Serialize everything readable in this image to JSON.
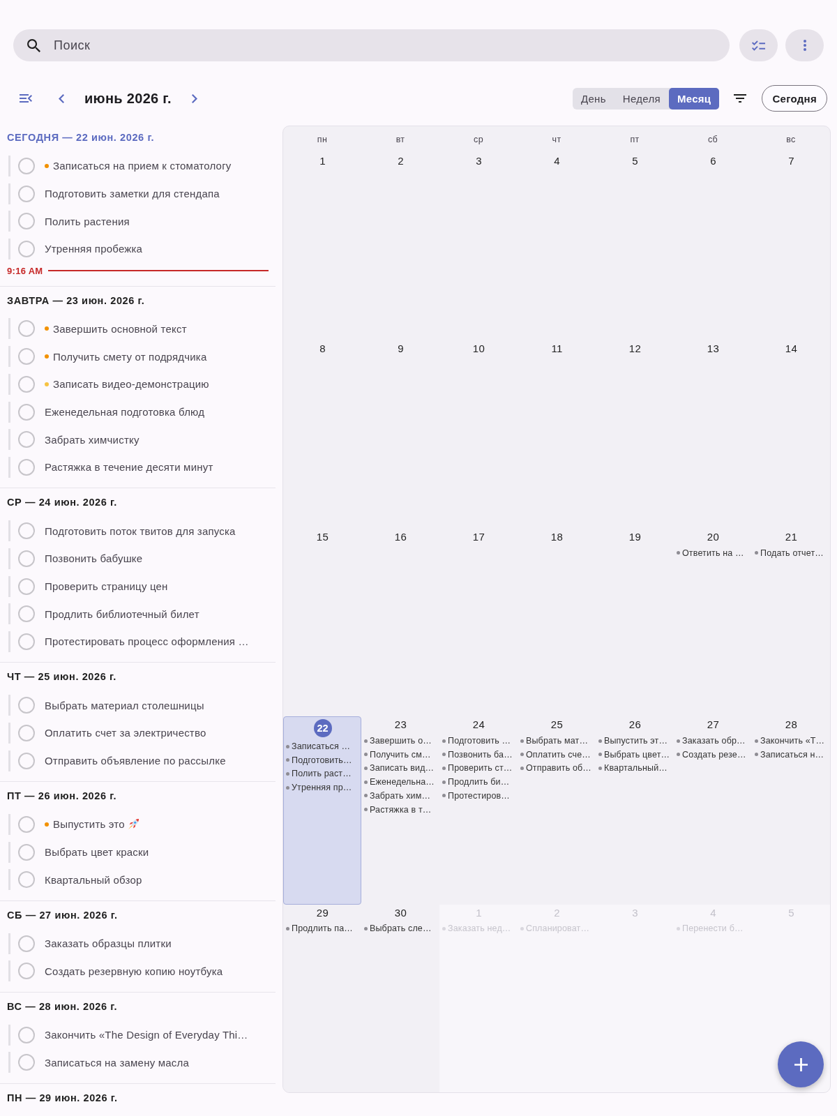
{
  "search": {
    "placeholder": "Поиск"
  },
  "header": {
    "title": "июнь 2026 г.",
    "views": [
      {
        "label": "День",
        "selected": false
      },
      {
        "label": "Неделя",
        "selected": false
      },
      {
        "label": "Месяц",
        "selected": true
      }
    ],
    "today_button": "Сегодня"
  },
  "agenda": {
    "sections": [
      {
        "title": "СЕГОДНЯ — 22 июн. 2026 г.",
        "today": true,
        "tasks": [
          {
            "text": "Записаться на прием к стоматологу",
            "checked": false,
            "color": "#f29100"
          },
          {
            "text": "Подготовить заметки для стендапа",
            "checked": false
          },
          {
            "text": "Полить растения",
            "checked": false
          },
          {
            "text": "Утренняя пробежка",
            "checked": false
          }
        ],
        "now_marker": "9:16 AM"
      },
      {
        "title": "ЗАВТРА — 23 июн. 2026 г.",
        "today": false,
        "tasks": [
          {
            "text": "Завершить основной текст",
            "checked": false,
            "color": "#f29100"
          },
          {
            "text": "Получить смету от подрядчика",
            "checked": false,
            "color": "#f29100"
          },
          {
            "text": "Записать видео-демонстрацию",
            "checked": false,
            "color": "#f6c343"
          },
          {
            "text": "Еженедельная подготовка блюд",
            "checked": false
          },
          {
            "text": "Забрать химчистку",
            "checked": false
          },
          {
            "text": "Растяжка в течение десяти минут",
            "checked": false
          }
        ]
      },
      {
        "title": "СР — 24 июн. 2026 г.",
        "today": false,
        "tasks": [
          {
            "text": "Подготовить поток твитов для запуска",
            "checked": false
          },
          {
            "text": "Позвонить бабушке",
            "checked": false
          },
          {
            "text": "Проверить страницу цен",
            "checked": false
          },
          {
            "text": "Продлить библиотечный билет",
            "checked": false
          },
          {
            "text": "Протестировать процесс оформления …",
            "checked": false
          }
        ]
      },
      {
        "title": "ЧТ — 25 июн. 2026 г.",
        "today": false,
        "tasks": [
          {
            "text": "Выбрать материал столешницы",
            "checked": false
          },
          {
            "text": "Оплатить счет за электричество",
            "checked": false
          },
          {
            "text": "Отправить объявление по рассылке",
            "checked": false
          }
        ]
      },
      {
        "title": "ПТ — 26 июн. 2026 г.",
        "today": false,
        "tasks": [
          {
            "text": "Выпустить это",
            "checked": false,
            "color": "#f29100",
            "emoji": true
          },
          {
            "text": "Выбрать цвет краски",
            "checked": false
          },
          {
            "text": "Квартальный обзор",
            "checked": false
          }
        ]
      },
      {
        "title": "СБ — 27 июн. 2026 г.",
        "today": false,
        "tasks": [
          {
            "text": "Заказать образцы плитки",
            "checked": false
          },
          {
            "text": "Создать резервную копию ноутбука",
            "checked": false
          }
        ]
      },
      {
        "title": "ВС — 28 июн. 2026 г.",
        "today": false,
        "tasks": [
          {
            "text": "Закончить «The Design of Everyday Thi…",
            "checked": false
          },
          {
            "text": "Записаться на замену масла",
            "checked": false
          }
        ]
      },
      {
        "title": "ПН — 29 июн. 2026 г.",
        "today": false
      }
    ]
  },
  "calendar": {
    "weekdays": [
      "пн",
      "вт",
      "ср",
      "чт",
      "пт",
      "сб",
      "вс"
    ],
    "weeks": [
      [
        {
          "day": "1",
          "today": false,
          "outside": false
        },
        {
          "day": "2",
          "today": false,
          "outside": false
        },
        {
          "day": "3",
          "today": false,
          "outside": false
        },
        {
          "day": "4",
          "today": false,
          "outside": false
        },
        {
          "day": "5",
          "today": false,
          "outside": false
        },
        {
          "day": "6",
          "today": false,
          "outside": false
        },
        {
          "day": "7",
          "today": false,
          "outside": false
        }
      ],
      [
        {
          "day": "8",
          "today": false,
          "outside": false
        },
        {
          "day": "9",
          "today": false,
          "outside": false
        },
        {
          "day": "10",
          "today": false,
          "outside": false
        },
        {
          "day": "11",
          "today": false,
          "outside": false
        },
        {
          "day": "12",
          "today": false,
          "outside": false
        },
        {
          "day": "13",
          "today": false,
          "outside": false
        },
        {
          "day": "14",
          "today": false,
          "outside": false
        }
      ],
      [
        {
          "day": "15",
          "today": false,
          "outside": false
        },
        {
          "day": "16",
          "today": false,
          "outside": false
        },
        {
          "day": "17",
          "today": false,
          "outside": false
        },
        {
          "day": "18",
          "today": false,
          "outside": false
        },
        {
          "day": "19",
          "today": false,
          "outside": false
        },
        {
          "day": "20",
          "today": false,
          "outside": false,
          "events": [
            "Ответить на …"
          ]
        },
        {
          "day": "21",
          "today": false,
          "outside": false,
          "events": [
            "Подать отчет…"
          ]
        }
      ],
      [
        {
          "day": "22",
          "today": true,
          "outside": false,
          "events": [
            "Записаться …",
            "Подготовить…",
            "Полить раст…",
            "Утренняя пр…"
          ]
        },
        {
          "day": "23",
          "today": false,
          "outside": false,
          "events": [
            "Завершить о…",
            "Получить см…",
            "Записать вид…",
            "Еженедельна…",
            "Забрать хим…",
            "Растяжка в т…"
          ]
        },
        {
          "day": "24",
          "today": false,
          "outside": false,
          "events": [
            "Подготовить …",
            "Позвонить ба…",
            "Проверить ст…",
            "Продлить би…",
            "Протестиров…"
          ]
        },
        {
          "day": "25",
          "today": false,
          "outside": false,
          "events": [
            "Выбрать мат…",
            "Оплатить сче…",
            "Отправить об…"
          ]
        },
        {
          "day": "26",
          "today": false,
          "outside": false,
          "events": [
            "Выпустить эт…",
            "Выбрать цвет…",
            "Квартальный…"
          ]
        },
        {
          "day": "27",
          "today": false,
          "outside": false,
          "events": [
            "Заказать обр…",
            "Создать резе…"
          ]
        },
        {
          "day": "28",
          "today": false,
          "outside": false,
          "events": [
            "Закончить «Т…",
            "Записаться н…"
          ]
        }
      ],
      [
        {
          "day": "29",
          "today": false,
          "outside": false,
          "events": [
            "Продлить па…"
          ]
        },
        {
          "day": "30",
          "today": false,
          "outside": false,
          "events": [
            "Выбрать сле…"
          ]
        },
        {
          "day": "1",
          "today": false,
          "outside": true,
          "events": [
            "Заказать нед…"
          ]
        },
        {
          "day": "2",
          "today": false,
          "outside": true,
          "events": [
            "Спланироват…"
          ]
        },
        {
          "day": "3",
          "today": false,
          "outside": true
        },
        {
          "day": "4",
          "today": false,
          "outside": true,
          "events": [
            "Перенести б…"
          ]
        },
        {
          "day": "5",
          "today": false,
          "outside": true
        }
      ]
    ]
  }
}
